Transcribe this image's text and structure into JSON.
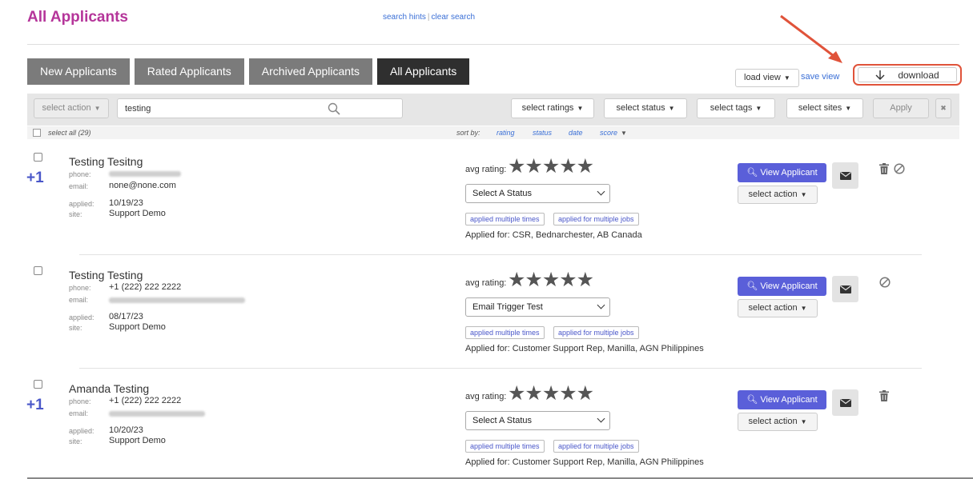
{
  "page": {
    "title": "All Applicants"
  },
  "colors": {
    "title": "#b5359a",
    "accent": "#5a5fd9",
    "link": "#3a6fd6",
    "highlight": "#e0533a",
    "tab": "#7b7b7b",
    "tab_active": "#2f2f2f"
  },
  "tabs": [
    {
      "label": "New Applicants",
      "active": false
    },
    {
      "label": "Rated Applicants",
      "active": false
    },
    {
      "label": "Archived Applicants",
      "active": false
    },
    {
      "label": "All Applicants",
      "active": true
    }
  ],
  "view": {
    "load_label": "load view",
    "save_label": "save view",
    "download_label": "download",
    "download_icon": "arrow-down-icon"
  },
  "filters": {
    "select_action": "select action",
    "search_value": "testing",
    "search_hints": "search hints",
    "clear_search": "clear search",
    "ratings": "select ratings",
    "status": "select status",
    "tags": "select tags",
    "sites": "select sites",
    "apply": "Apply",
    "close": "✖"
  },
  "list_header": {
    "select_all": "select all (29)",
    "sort_by": "sort by:",
    "sort_options": [
      "rating",
      "status",
      "date",
      "score"
    ]
  },
  "applicant_ui": {
    "phone_label": "phone:",
    "email_label": "email:",
    "applied_label": "applied:",
    "site_label": "site:",
    "avg_rating_label": "avg rating:",
    "stars": "★★★★★",
    "view_label": "View Applicant",
    "action_label": "select action"
  },
  "applicants": [
    {
      "badge": "+1",
      "name": "Testing Tesitng",
      "phone": "",
      "email": "none@none.com",
      "applied": "10/19/23",
      "site": "Support Demo",
      "status": "Select A Status",
      "tags": [
        "applied multiple times",
        "applied for multiple jobs"
      ],
      "applied_for": "Applied for: CSR, Bednarchester, AB Canada"
    },
    {
      "badge": "",
      "name": "Testing Testing",
      "phone": "+1 (222) 222 2222",
      "email": "",
      "applied": "08/17/23",
      "site": "Support Demo",
      "status": "Email Trigger Test",
      "tags": [
        "applied multiple times",
        "applied for multiple jobs"
      ],
      "applied_for": "Applied for: Customer Support Rep, Manilla, AGN Philippines"
    },
    {
      "badge": "+1",
      "name": "Amanda Testing",
      "phone": "+1 (222) 222 2222",
      "email": "",
      "applied": "10/20/23",
      "site": "Support Demo",
      "status": "Select A Status",
      "tags": [
        "applied multiple times",
        "applied for multiple jobs"
      ],
      "applied_for": "Applied for: Customer Support Rep, Manilla, AGN Philippines"
    }
  ]
}
